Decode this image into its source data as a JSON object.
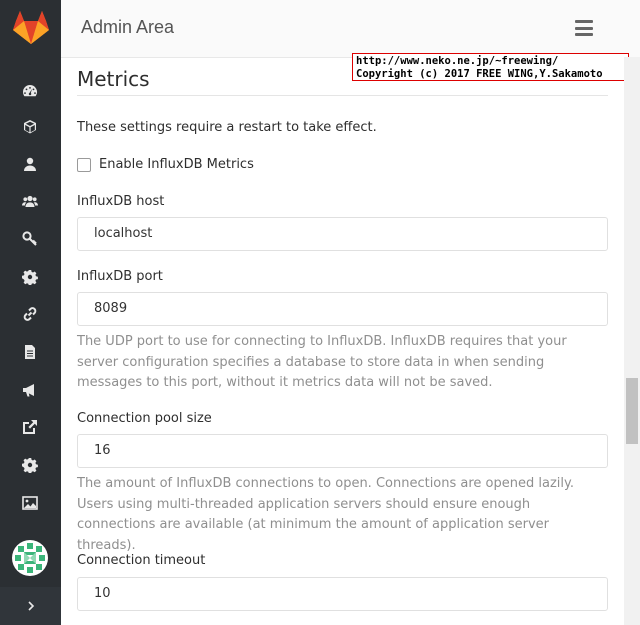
{
  "header": {
    "title": "Admin Area"
  },
  "watermark": {
    "line1": "http://www.neko.ne.jp/~freewing/",
    "line2": "Copyright (c) 2017 FREE WING,Y.Sakamoto"
  },
  "sidebar": {
    "items": [
      {
        "name": "dashboard-icon"
      },
      {
        "name": "projects-icon"
      },
      {
        "name": "users-icon"
      },
      {
        "name": "groups-icon"
      },
      {
        "name": "deploy-keys-icon"
      },
      {
        "name": "settings-cog-icon"
      },
      {
        "name": "hooks-icon"
      },
      {
        "name": "logs-icon"
      },
      {
        "name": "messages-icon"
      },
      {
        "name": "external-link-icon"
      },
      {
        "name": "settings-icon"
      },
      {
        "name": "appearance-icon"
      }
    ]
  },
  "metrics": {
    "title": "Metrics",
    "restart_note": "These settings require a restart to take effect.",
    "enable_label": "Enable InfluxDB Metrics",
    "host_label": "InfluxDB host",
    "host_value": "localhost",
    "port_label": "InfluxDB port",
    "port_value": "8089",
    "port_help": "The UDP port to use for connecting to InfluxDB. InfluxDB requires that your server configuration specifies a database to store data in when sending messages to this port, without it metrics data will not be saved.",
    "pool_label": "Connection pool size",
    "pool_value": "16",
    "pool_help": "The amount of InfluxDB connections to open. Connections are opened lazily. Users using multi-threaded application servers should ensure enough connections are available (at minimum the amount of application server threads).",
    "timeout_label": "Connection timeout",
    "timeout_value": "10"
  },
  "colors": {
    "sidebar_bg": "#2b2f33",
    "accent_orange": "#e24329"
  }
}
